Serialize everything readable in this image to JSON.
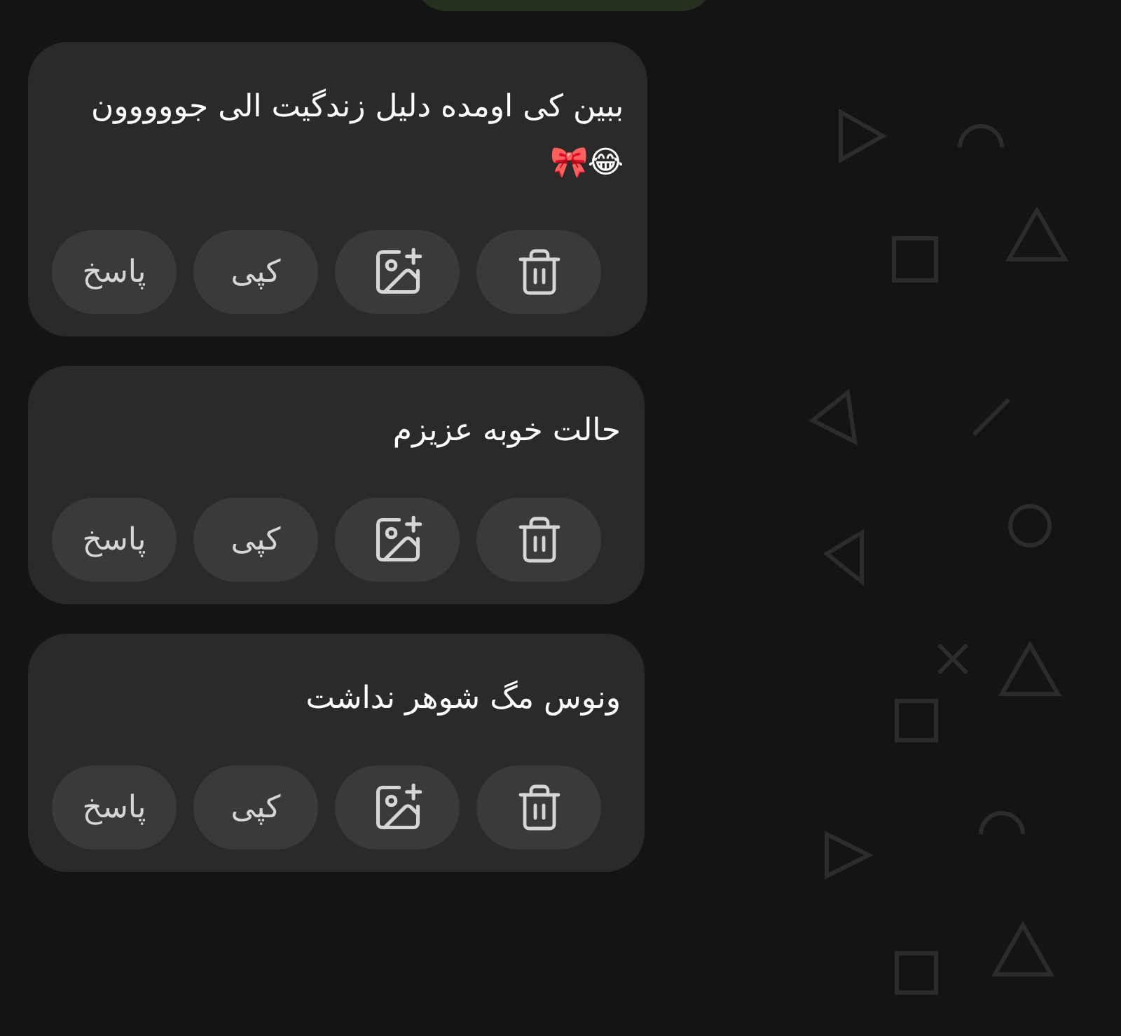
{
  "messages": [
    {
      "lines": [
        "ببین کی اومده دلیل زندگیت الی جووووون",
        "😂🎀"
      ],
      "actions": [
        {
          "kind": "delete"
        },
        {
          "kind": "add_image"
        },
        {
          "kind": "text",
          "label": "کپی"
        },
        {
          "kind": "text",
          "label": "پاسخ"
        }
      ]
    },
    {
      "lines": [
        "حالت خوبه عزیزم"
      ],
      "actions": [
        {
          "kind": "delete"
        },
        {
          "kind": "add_image"
        },
        {
          "kind": "text",
          "label": "کپی"
        },
        {
          "kind": "text",
          "label": "پاسخ"
        }
      ]
    },
    {
      "lines": [
        "ونوس مگ شوهر نداشت"
      ],
      "actions": [
        {
          "kind": "delete"
        },
        {
          "kind": "add_image"
        },
        {
          "kind": "text",
          "label": "کپی"
        },
        {
          "kind": "text",
          "label": "پاسخ"
        }
      ]
    }
  ]
}
